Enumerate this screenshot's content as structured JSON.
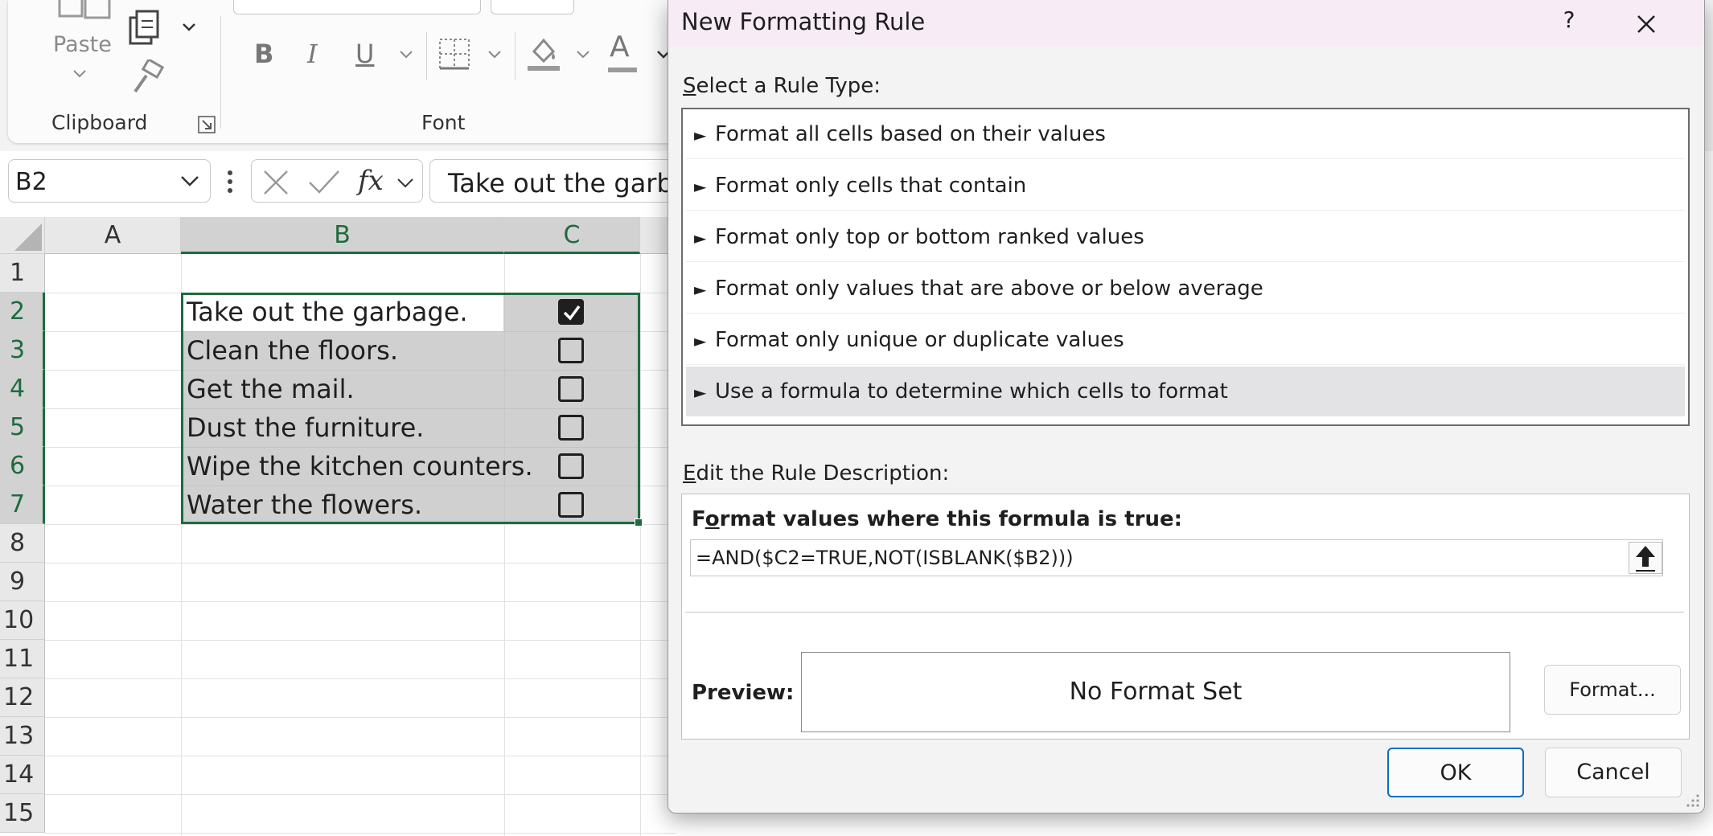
{
  "ribbon": {
    "clipboard": {
      "paste_label": "Paste",
      "group_label": "Clipboard"
    },
    "font": {
      "group_label": "Font",
      "bold": "B",
      "italic": "I",
      "underline": "U",
      "font_color_glyph": "A"
    }
  },
  "formula_bar": {
    "name_box": "B2",
    "fx_label": "fx",
    "formula": "Take out the garbage."
  },
  "grid": {
    "columns": [
      "A",
      "B",
      "C"
    ],
    "rows": [
      "1",
      "2",
      "3",
      "4",
      "5",
      "6",
      "7",
      "8",
      "9",
      "10",
      "11",
      "12",
      "13",
      "14",
      "15"
    ],
    "tasks": [
      {
        "text": "Take out the garbage.",
        "checked": true
      },
      {
        "text": "Clean the floors.",
        "checked": false
      },
      {
        "text": "Get the mail.",
        "checked": false
      },
      {
        "text": "Dust the furniture.",
        "checked": false
      },
      {
        "text": "Wipe the kitchen counters.",
        "checked": false
      },
      {
        "text": "Water the flowers.",
        "checked": false
      }
    ]
  },
  "dialog": {
    "title": "New Formatting Rule",
    "help": "?",
    "rule_type_label_prefix": "S",
    "rule_type_label_rest": "elect a Rule Type:",
    "rule_types": [
      "Format all cells based on their values",
      "Format only cells that contain",
      "Format only top or bottom ranked values",
      "Format only values that are above or below average",
      "Format only unique or duplicate values",
      "Use a formula to determine which cells to format"
    ],
    "selected_rule_index": 5,
    "description_label_prefix": "E",
    "description_label_rest": "dit the Rule Description:",
    "formula_heading_prefix": "F",
    "formula_heading_mid": "o",
    "formula_heading_rest": "rmat values where this formula is true:",
    "formula_value": "=AND($C2=TRUE,NOT(ISBLANK($B2)))",
    "preview_label": "Preview:",
    "preview_text": "No Format Set",
    "format_button": "Format...",
    "ok_button": "OK",
    "cancel_button": "Cancel"
  },
  "colors": {
    "selection_green": "#1e6b3e",
    "title_bar": "#f7ecf6",
    "primary_border": "#0f6cbd"
  }
}
